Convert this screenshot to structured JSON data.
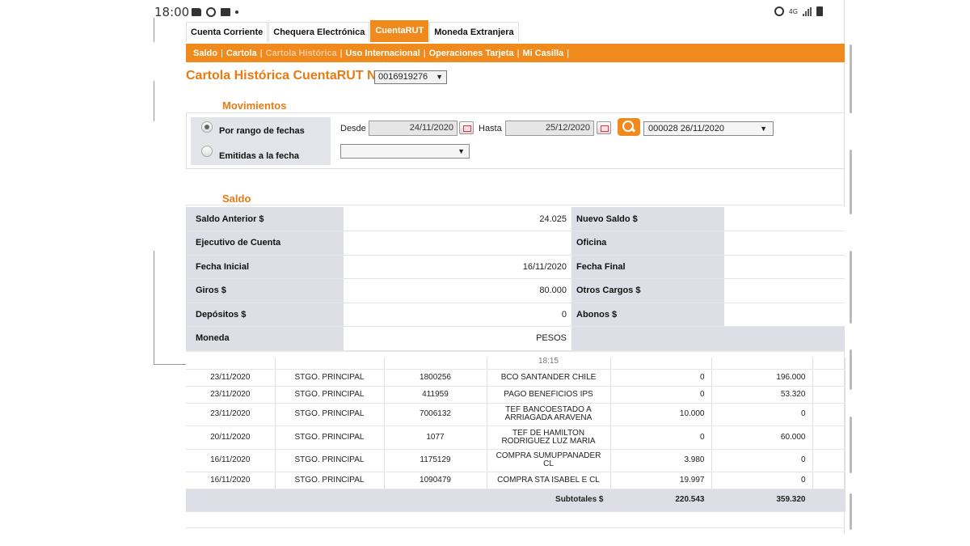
{
  "status_bar": {
    "time": "18:00",
    "network": "4G",
    "icons": [
      "folder-icon",
      "alarm-icon",
      "square-icon",
      "dot-icon",
      "alarm-icon",
      "signal-icon",
      "battery-icon"
    ]
  },
  "tabs": [
    {
      "label": "Cuenta Corriente",
      "active": false
    },
    {
      "label": "Chequera Electrónica",
      "active": false
    },
    {
      "label": "CuentaRUT",
      "active": true
    },
    {
      "label": "Moneda Extranjera",
      "active": false
    }
  ],
  "subnav": [
    {
      "label": "Saldo",
      "current": false
    },
    {
      "label": "Cartola",
      "current": false
    },
    {
      "label": "Cartola Histórica",
      "current": true
    },
    {
      "label": "Uso Internacional",
      "current": false
    },
    {
      "label": "Operaciones Tarjeta",
      "current": false
    },
    {
      "label": "Mi Casilla",
      "current": false
    }
  ],
  "page": {
    "title": "Cartola Histórica CuentaRUT Nº",
    "account": "0016919276"
  },
  "movimientos": {
    "title": "Movimientos",
    "option_range": "Por rango de fechas",
    "option_emitted": "Emitidas a la fecha",
    "desde_label": "Desde",
    "desde_value": "24/11/2020",
    "hasta_label": "Hasta",
    "hasta_value": "25/12/2020",
    "cartola_select": "000028 26/11/2020",
    "emitidas_select": ""
  },
  "saldo": {
    "title": "Saldo",
    "rows": [
      {
        "k1": "Saldo Anterior $",
        "v1": "24.025",
        "k2": "Nuevo Saldo $",
        "v2": ""
      },
      {
        "k1": "Ejecutivo de Cuenta",
        "v1": "",
        "k2": "Oficina",
        "v2": ""
      },
      {
        "k1": "Fecha Inicial",
        "v1": "16/11/2020",
        "k2": "Fecha Final",
        "v2": ""
      },
      {
        "k1": "Giros $",
        "v1": "80.000",
        "k2": "Otros Cargos $",
        "v2": ""
      },
      {
        "k1": "Depósitos $",
        "v1": "0",
        "k2": "Abonos $",
        "v2": ""
      },
      {
        "k1": "Moneda",
        "v1": "PESOS",
        "k2": "",
        "v2": ""
      }
    ]
  },
  "movements": {
    "partial_text": "18:15",
    "rows": [
      {
        "fecha": "23/11/2020",
        "sucursal": "STGO. PRINCIPAL",
        "doc": "1800256",
        "desc": "BCO SANTANDER CHILE",
        "cargo": "0",
        "abono": "196.000"
      },
      {
        "fecha": "23/11/2020",
        "sucursal": "STGO. PRINCIPAL",
        "doc": "411959",
        "desc": "PAGO BENEFICIOS IPS",
        "cargo": "0",
        "abono": "53.320"
      },
      {
        "fecha": "23/11/2020",
        "sucursal": "STGO. PRINCIPAL",
        "doc": "7006132",
        "desc": "TEF BANCOESTADO A ARRIAGADA ARAVENA",
        "cargo": "10.000",
        "abono": "0"
      },
      {
        "fecha": "20/11/2020",
        "sucursal": "STGO. PRINCIPAL",
        "doc": "1077",
        "desc": "TEF DE HAMILTON RODRIGUEZ LUZ MARIA",
        "cargo": "0",
        "abono": "60.000"
      },
      {
        "fecha": "16/11/2020",
        "sucursal": "STGO. PRINCIPAL",
        "doc": "1175129",
        "desc": "COMPRA SUMUPPANADER CL",
        "cargo": "3.980",
        "abono": "0"
      },
      {
        "fecha": "16/11/2020",
        "sucursal": "STGO. PRINCIPAL",
        "doc": "1090479",
        "desc": "COMPRA STA ISABEL E CL",
        "cargo": "19.997",
        "abono": "0"
      }
    ],
    "subtotal_label": "Subtotales $",
    "subtotal_cargos": "220.543",
    "subtotal_abonos": "359.320"
  }
}
